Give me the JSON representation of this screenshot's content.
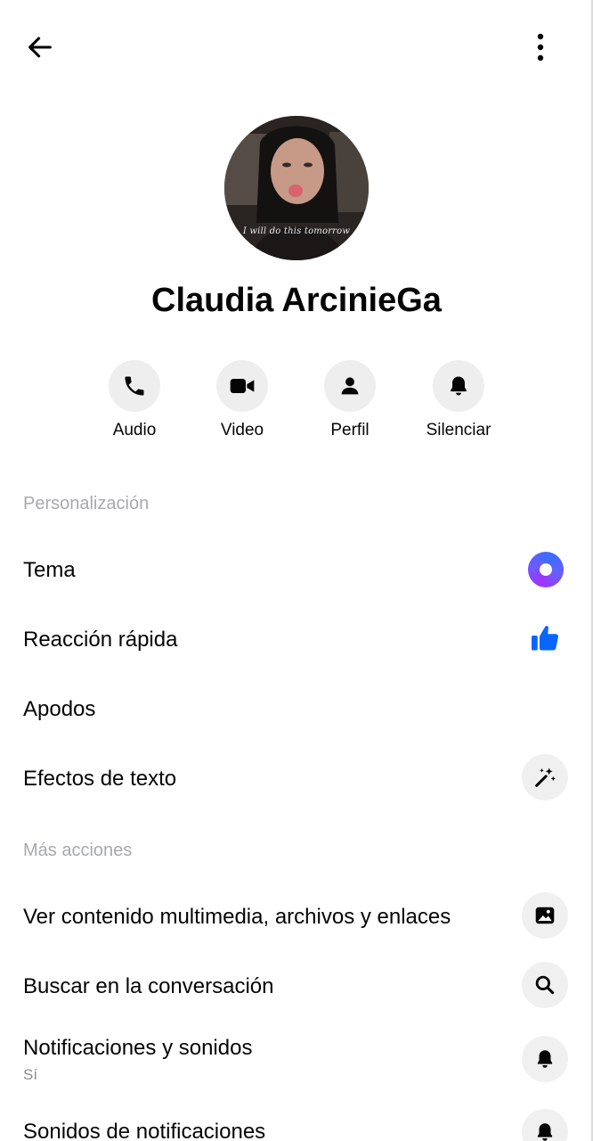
{
  "header": {
    "back_icon": "arrow-left-icon",
    "more_icon": "more-vertical-icon"
  },
  "profile": {
    "name": "Claudia ArcinieGa",
    "avatar_caption": "I will do this tomorrow"
  },
  "actions": [
    {
      "label": "Audio",
      "icon": "phone-icon"
    },
    {
      "label": "Video",
      "icon": "video-camera-icon"
    },
    {
      "label": "Perfil",
      "icon": "person-icon"
    },
    {
      "label": "Silenciar",
      "icon": "bell-icon"
    }
  ],
  "personalization": {
    "header": "Personalización",
    "items": [
      {
        "label": "Tema",
        "icon": "theme-color-icon"
      },
      {
        "label": "Reacción rápida",
        "icon": "thumbs-up-icon"
      },
      {
        "label": "Apodos"
      },
      {
        "label": "Efectos de texto",
        "icon": "magic-wand-icon"
      }
    ]
  },
  "more_actions": {
    "header": "Más acciones",
    "items": [
      {
        "label": "Ver contenido multimedia, archivos y enlaces",
        "icon": "image-icon"
      },
      {
        "label": "Buscar en la conversación",
        "icon": "search-icon"
      },
      {
        "label": "Notificaciones y sonidos",
        "sub": "Sí",
        "icon": "bell-icon"
      },
      {
        "label": "Sonidos de notificaciones",
        "icon": "bell-icon"
      }
    ]
  },
  "colors": {
    "accent": "#0866ff",
    "theme_gradient_start": "#a033ff",
    "theme_gradient_end": "#3b6dff",
    "icon_bg": "#eeeeee",
    "section_header": "#a7a9ad"
  }
}
